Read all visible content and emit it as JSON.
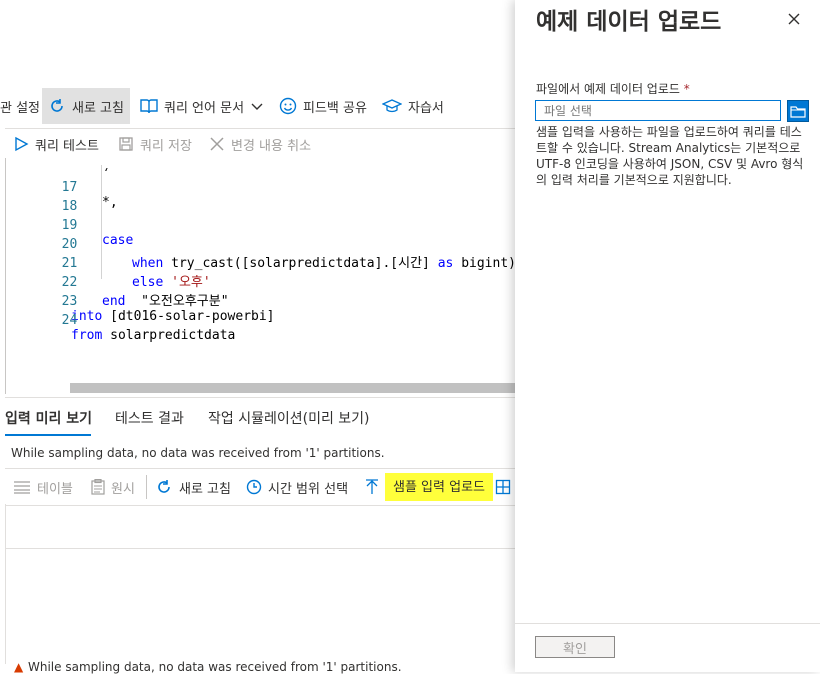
{
  "toolbar": {
    "settings_partial": "관 설정",
    "refresh": "새로 고침",
    "query_lang_docs": "쿼리 언어 문서",
    "feedback": "피드백 공유",
    "tutorial": "자습서"
  },
  "editor_toolbar": {
    "test_query": "쿼리 테스트",
    "save_query": "쿼리 저장",
    "discard": "변경 내용 취소"
  },
  "code": {
    "line_numbers": [
      "17",
      "18",
      "19",
      "20",
      "21",
      "22",
      "23",
      "24"
    ],
    "line17": "*,",
    "line19": "case",
    "line20_kw": "when",
    "line20_body": "try_cast([solarpredictdata].[시간]",
    "line20_as": "as",
    "line20_type": "bigint)",
    "line21_kw": "else",
    "line21_str": "'오후'",
    "line22_kw": "end",
    "line22_alias": "\"오전오후구분\"",
    "line23_kw": "into",
    "line23_target": "[dt016-solar-powerbi]",
    "line24_kw": "from",
    "line24_source": "solarpredictdata"
  },
  "tabs": {
    "input_preview": "입력 미리 보기",
    "test_results": "테스트 결과",
    "job_simulation": "작업 시뮬레이션(미리 보기)"
  },
  "message": "While sampling data, no data was received from '1' partitions.",
  "bottom_toolbar": {
    "table": "테이블",
    "raw": "원시",
    "refresh": "새로 고침",
    "time_range": "시간 범위 선택",
    "upload_sample": "샘플 입력 업로드"
  },
  "warning": "While sampling data, no data was received from '1' partitions.",
  "panel": {
    "title": "예제 데이터 업로드",
    "field_label": "파일에서 예제 데이터 업로드",
    "required_mark": "*",
    "file_placeholder": "파일 선택",
    "help": "샘플 입력을 사용하는 파일을 업로드하여 쿼리를 테스트할 수 있습니다. Stream Analytics는 기본적으로 UTF-8 인코딩을 사용하여 JSON, CSV 및 Avro 형식의 입력 처리를 기본적으로 지원합니다.",
    "confirm": "확인"
  },
  "colors": {
    "accent": "#0078d4",
    "highlight": "#ffff3b",
    "keyword": "#0000ff",
    "string": "#a31515"
  }
}
